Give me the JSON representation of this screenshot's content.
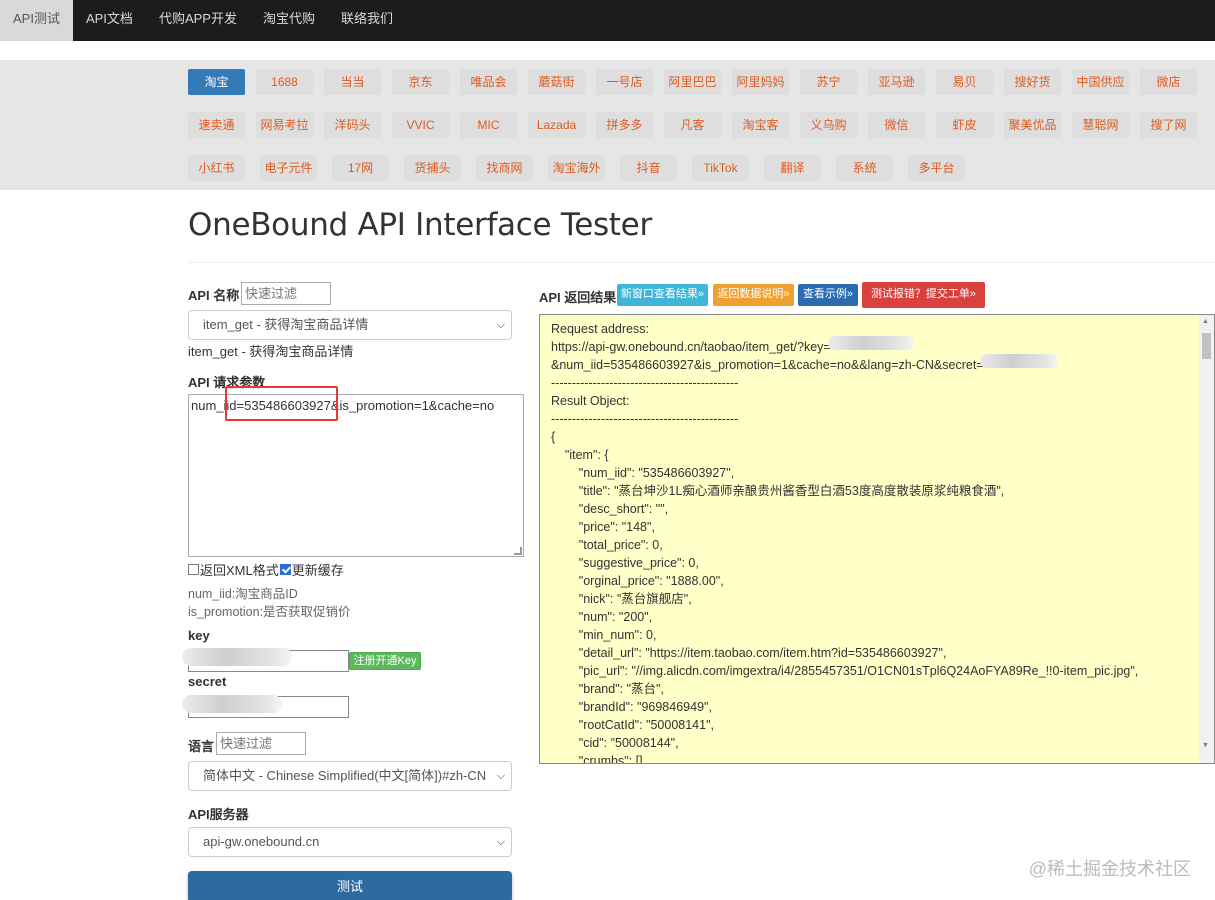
{
  "nav": {
    "tabs": [
      {
        "label": "API测试",
        "active": true
      },
      {
        "label": "API文档"
      },
      {
        "label": "代购APP开发"
      },
      {
        "label": "淘宝代购"
      },
      {
        "label": "联络我们"
      }
    ]
  },
  "platforms": {
    "row1": [
      "淘宝",
      "1688",
      "当当",
      "京东",
      "唯品会",
      "蘑菇街",
      "一号店",
      "阿里巴巴",
      "阿里妈妈",
      "苏宁",
      "亚马逊",
      "易贝",
      "搜好货",
      "中国供应",
      "微店"
    ],
    "row2": [
      "速卖通",
      "网易考拉",
      "洋码头",
      "VVIC",
      "MIC",
      "Lazada",
      "拼多多",
      "凡客",
      "淘宝客",
      "义乌购",
      "微信",
      "虾皮",
      "聚美优品",
      "慧聪网",
      "搜了网"
    ],
    "row3": [
      "小红书",
      "电子元件",
      "17网",
      "货捕头",
      "找商网",
      "淘宝海外",
      "抖音",
      "TikTok",
      "翻译",
      "系统",
      "多平台"
    ],
    "active": "淘宝"
  },
  "page_title": "OneBound API Interface Tester",
  "form": {
    "api_name_label": "API 名称",
    "filter_placeholder": "快速过滤",
    "api_select_value": "item_get - 获得淘宝商品详情",
    "api_desc": "item_get - 获得淘宝商品详情",
    "params_label": "API 请求参数",
    "params_value": "num_iid=535486603927&is_promotion=1&cache=no",
    "xml_checkbox_label": "返回XML格式",
    "xml_checked": false,
    "cache_checkbox_label": "更新缓存",
    "cache_checked": true,
    "hint1": "num_iid:淘宝商品ID",
    "hint2": "is_promotion:是否获取促销价",
    "key_label": "key",
    "register_button": "注册开通Key",
    "secret_label": "secret",
    "lang_label": "语言",
    "lang_select_value": "简体中文 - Chinese Simplified(中文[简体])#zh-CN",
    "server_label": "API服务器",
    "server_select_value": "api-gw.onebound.cn",
    "test_button": "测试"
  },
  "result": {
    "label": "API 返回结果",
    "buttons": [
      {
        "label": "新窗口查看结果»",
        "color": "#3fb6d8"
      },
      {
        "label": "返回数据说明»",
        "color": "#f0a030"
      },
      {
        "label": "查看示例»",
        "color": "#2b6cb0"
      },
      {
        "label": "测试报错？提交工单»",
        "color": "#d9413d"
      }
    ],
    "text": "Request address:\nhttps://api-gw.onebound.cn/taobao/item_get/?key=\n&num_iid=535486603927&is_promotion=1&cache=no&&lang=zh-CN&secret=\n---------------------------------------------\nResult Object:\n---------------------------------------------\n{\n\t\"item\": {\n\t\t\"num_iid\": \"535486603927\",\n\t\t\"title\": \"蒸台坤沙1L痴心酒师亲酿贵州酱香型白酒53度高度散装原浆纯粮食酒\",\n\t\t\"desc_short\": \"\",\n\t\t\"price\": \"148\",\n\t\t\"total_price\": 0,\n\t\t\"suggestive_price\": 0,\n\t\t\"orginal_price\": \"1888.00\",\n\t\t\"nick\": \"蒸台旗舰店\",\n\t\t\"num\": \"200\",\n\t\t\"min_num\": 0,\n\t\t\"detail_url\": \"https://item.taobao.com/item.htm?id=535486603927\",\n\t\t\"pic_url\": \"//img.alicdn.com/imgextra/i4/2855457351/O1CN01sTpl6Q24AoFYA89Re_!!0-item_pic.jpg\",\n\t\t\"brand\": \"蒸台\",\n\t\t\"brandId\": \"969846949\",\n\t\t\"rootCatId\": \"50008141\",\n\t\t\"cid\": \"50008144\",\n\t\t\"crumbs\": []"
  },
  "watermark": "@稀土掘金技术社区"
}
